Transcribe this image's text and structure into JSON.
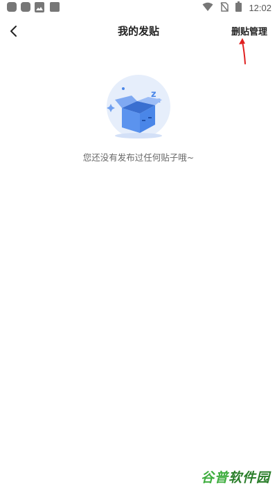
{
  "status_bar": {
    "time": "12:02",
    "icons": [
      "app-icon",
      "app-icon",
      "image-icon",
      "app-icon",
      "wifi-icon",
      "no-sim-icon",
      "battery-icon"
    ]
  },
  "header": {
    "title": "我的发贴",
    "manage_label": "删贴管理",
    "back_icon": "chevron-left-icon"
  },
  "empty_state": {
    "illustration": "empty-box-icon",
    "message": "您还没有发布过任何贴子哦~"
  },
  "watermark": {
    "text_part1": "谷普",
    "text_part2": "软件园"
  },
  "colors": {
    "annotation_arrow": "#e02020",
    "illustration_blue": "#4a86e8",
    "illustration_bg": "#e6eefb",
    "watermark_green": "#3fae3f"
  }
}
